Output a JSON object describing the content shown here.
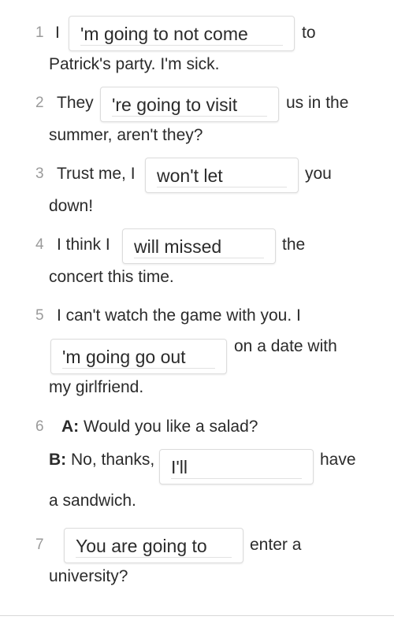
{
  "questions": [
    {
      "number": "1",
      "before": "I",
      "answer": "'m going to not come",
      "after": "to",
      "continuation": "Patrick's party. I'm sick."
    },
    {
      "number": "2",
      "before": "They",
      "answer": "'re going to visit",
      "after": "us in the",
      "continuation": "summer, aren't they?"
    },
    {
      "number": "3",
      "before": "Trust me, I",
      "answer": "won't let",
      "after": "you",
      "continuation": "down!"
    },
    {
      "number": "4",
      "before": "I think I",
      "answer": "will missed",
      "after": "the",
      "continuation": "concert this time."
    },
    {
      "number": "5",
      "before": "I can't watch the game with you. I",
      "answer": "'m going go out",
      "after": "on a date with",
      "continuation": "my girlfriend."
    },
    {
      "number": "6",
      "speaker_a": "A:",
      "line_a": "Would you like a salad?",
      "speaker_b": "B:",
      "before": "No, thanks,",
      "answer": "I'll",
      "after": "have",
      "continuation": "a sandwich."
    },
    {
      "number": "7",
      "before": "",
      "answer": "You are going to",
      "after": "enter a",
      "continuation": "university?"
    }
  ]
}
